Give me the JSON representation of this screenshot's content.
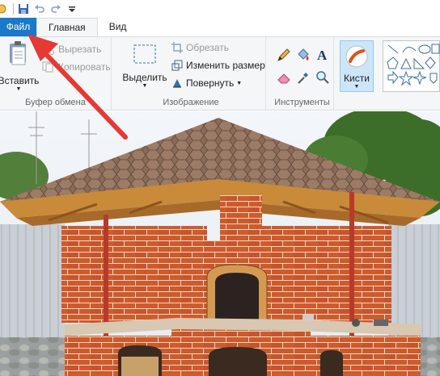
{
  "tabs": {
    "file": "Файл",
    "home": "Главная",
    "view": "Вид"
  },
  "clipboard": {
    "paste": "Вставить",
    "cut": "Вырезать",
    "copy": "Копировать",
    "group_label": "Буфер обмена"
  },
  "image": {
    "select": "Выделить",
    "crop": "Обрезать",
    "resize": "Изменить размер",
    "rotate": "Повернуть",
    "group_label": "Изображение"
  },
  "tools": {
    "group_label": "Инструменты",
    "icons": [
      "pencil-icon",
      "fill-icon",
      "text-icon",
      "eraser-icon",
      "color-picker-icon",
      "magnifier-icon"
    ]
  },
  "brushes": {
    "label": "Кисти"
  },
  "colors": {
    "file_tab": "#1979ca",
    "ribbon_bg": "#f5f6f7",
    "brush_active": "#cde6f7",
    "annotation_arrow": "#e53935"
  }
}
